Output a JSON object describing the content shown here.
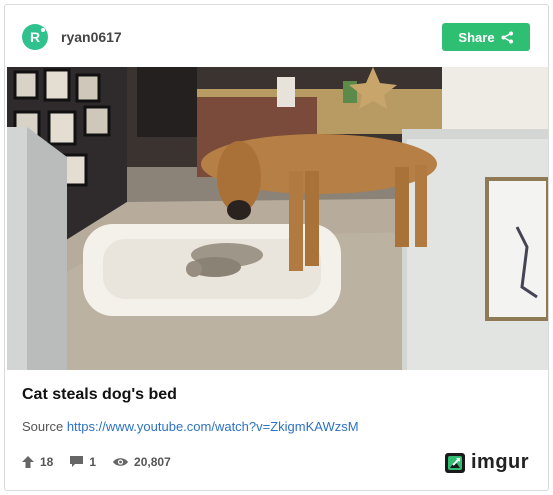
{
  "post": {
    "user": {
      "avatar_letter": "R",
      "username": "ryan0617"
    },
    "share_label": "Share",
    "media": {},
    "title": "Cat steals dog's bed",
    "source": {
      "label": "Source",
      "url": "https://www.youtube.com/watch?v=ZkigmKAWzsM"
    },
    "stats": {
      "upvotes": "18",
      "comments": "1",
      "views": "20,807"
    },
    "brand": "imgur"
  },
  "colors": {
    "accent_green": "#2fbf73",
    "avatar_green": "#2fc28e",
    "link_blue": "#2d72c4"
  }
}
